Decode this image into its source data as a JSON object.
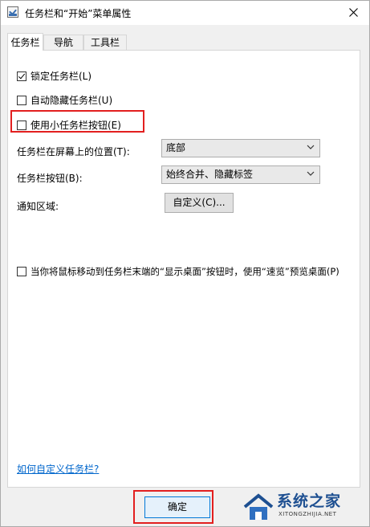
{
  "window": {
    "title": "任务栏和“开始”菜单属性"
  },
  "tabs": [
    {
      "label": "任务栏",
      "active": true
    },
    {
      "label": "导航",
      "active": false
    },
    {
      "label": "工具栏",
      "active": false
    }
  ],
  "options": {
    "lock_taskbar": {
      "label": "锁定任务栏(L)",
      "checked": true
    },
    "auto_hide": {
      "label": "自动隐藏任务栏(U)",
      "checked": false
    },
    "small_buttons": {
      "label": "使用小任务栏按钮(E)",
      "checked": false
    },
    "peek": {
      "label": "当你将鼠标移动到任务栏末端的“显示桌面”按钮时，使用“速览”预览桌面(P)",
      "checked": false
    }
  },
  "location": {
    "label": "任务栏在屏幕上的位置(T):",
    "value": "底部"
  },
  "buttons": {
    "label": "任务栏按钮(B):",
    "value": "始终合并、隐藏标签"
  },
  "notify": {
    "label": "通知区域:",
    "customize_label": "自定义(C)..."
  },
  "help_link": "如何自定义任务栏?",
  "footer": {
    "ok_label": "确定"
  },
  "watermark": {
    "text": "系统之家",
    "sub": "XITONGZHIJIA.NET"
  },
  "colors": {
    "highlight": "#e21f1f",
    "link": "#0066cc",
    "brand": "#1d4f91"
  }
}
